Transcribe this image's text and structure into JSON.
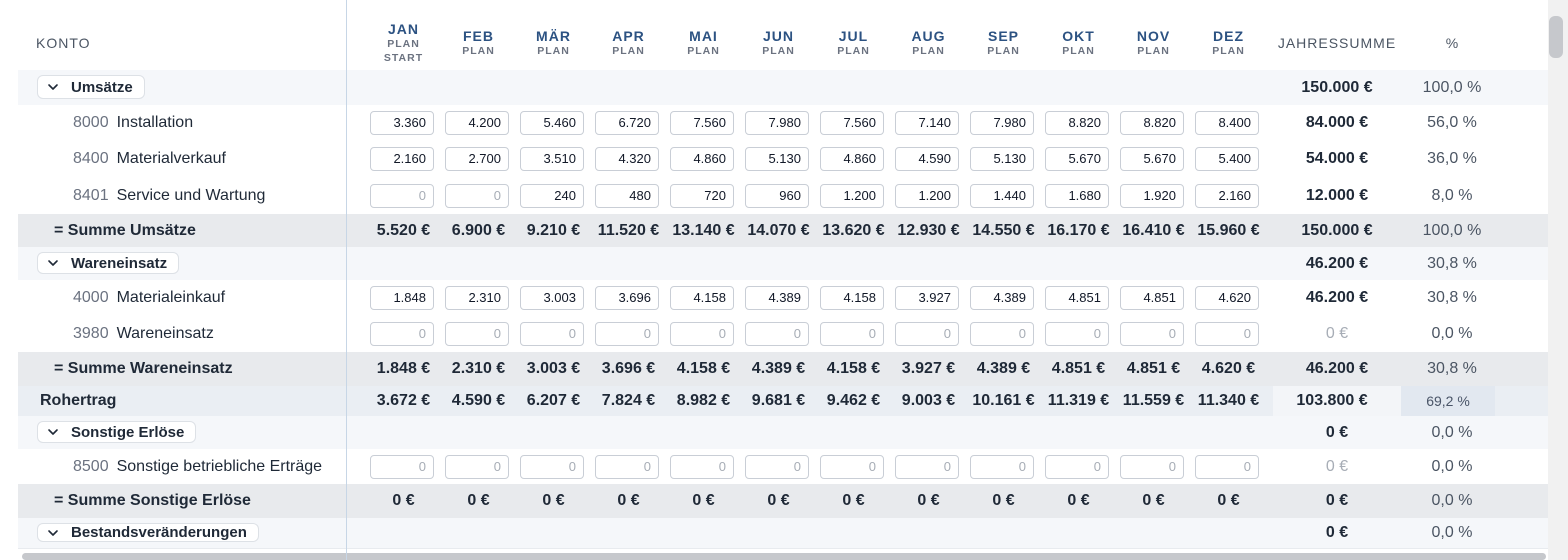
{
  "header": {
    "konto": "KONTO",
    "months": [
      {
        "name": "JAN",
        "l1": "PLAN",
        "l2": "START"
      },
      {
        "name": "FEB",
        "l1": "PLAN"
      },
      {
        "name": "MÄR",
        "l1": "PLAN"
      },
      {
        "name": "APR",
        "l1": "PLAN"
      },
      {
        "name": "MAI",
        "l1": "PLAN"
      },
      {
        "name": "JUN",
        "l1": "PLAN"
      },
      {
        "name": "JUL",
        "l1": "PLAN"
      },
      {
        "name": "AUG",
        "l1": "PLAN"
      },
      {
        "name": "SEP",
        "l1": "PLAN"
      },
      {
        "name": "OKT",
        "l1": "PLAN"
      },
      {
        "name": "NOV",
        "l1": "PLAN"
      },
      {
        "name": "DEZ",
        "l1": "PLAN"
      }
    ],
    "jahressumme": "JAHRESSUMME",
    "percent": "%"
  },
  "rows": [
    {
      "type": "group",
      "label": "Umsätze",
      "sum": "150.000 €",
      "pct": "100,0 %"
    },
    {
      "type": "item",
      "num": "8000",
      "name": "Installation",
      "values": [
        "3.360",
        "4.200",
        "5.460",
        "6.720",
        "7.560",
        "7.980",
        "7.560",
        "7.140",
        "7.980",
        "8.820",
        "8.820",
        "8.400"
      ],
      "sum": "84.000 €",
      "pct": "56,0 %"
    },
    {
      "type": "item",
      "num": "8400",
      "name": "Materialverkauf",
      "values": [
        "2.160",
        "2.700",
        "3.510",
        "4.320",
        "4.860",
        "5.130",
        "4.860",
        "4.590",
        "5.130",
        "5.670",
        "5.670",
        "5.400"
      ],
      "sum": "54.000 €",
      "pct": "36,0 %"
    },
    {
      "type": "item",
      "num": "8401",
      "name": "Service und Wartung",
      "values": [
        "0",
        "0",
        "240",
        "480",
        "720",
        "960",
        "1.200",
        "1.200",
        "1.440",
        "1.680",
        "1.920",
        "2.160"
      ],
      "sum": "12.000 €",
      "pct": "8,0 %"
    },
    {
      "type": "sum",
      "label": "= Summe Umsätze",
      "values": [
        "5.520 €",
        "6.900 €",
        "9.210 €",
        "11.520 €",
        "13.140 €",
        "14.070 €",
        "13.620 €",
        "12.930 €",
        "14.550 €",
        "16.170 €",
        "16.410 €",
        "15.960 €"
      ],
      "sum": "150.000 €",
      "pct": "100,0 %"
    },
    {
      "type": "group",
      "label": "Wareneinsatz",
      "sum": "46.200 €",
      "pct": "30,8 %"
    },
    {
      "type": "item",
      "num": "4000",
      "name": "Materialeinkauf",
      "values": [
        "1.848",
        "2.310",
        "3.003",
        "3.696",
        "4.158",
        "4.389",
        "4.158",
        "3.927",
        "4.389",
        "4.851",
        "4.851",
        "4.620"
      ],
      "sum": "46.200 €",
      "pct": "30,8 %"
    },
    {
      "type": "item",
      "num": "3980",
      "name": "Wareneinsatz",
      "values": [
        "0",
        "0",
        "0",
        "0",
        "0",
        "0",
        "0",
        "0",
        "0",
        "0",
        "0",
        "0"
      ],
      "sum": "0 €",
      "pct": "0,0 %"
    },
    {
      "type": "sum",
      "label": "= Summe Wareneinsatz",
      "values": [
        "1.848 €",
        "2.310 €",
        "3.003 €",
        "3.696 €",
        "4.158 €",
        "4.389 €",
        "4.158 €",
        "3.927 €",
        "4.389 €",
        "4.851 €",
        "4.851 €",
        "4.620 €"
      ],
      "sum": "46.200 €",
      "pct": "30,8 %"
    },
    {
      "type": "roh",
      "label": "Rohertrag",
      "values": [
        "3.672 €",
        "4.590 €",
        "6.207 €",
        "7.824 €",
        "8.982 €",
        "9.681 €",
        "9.462 €",
        "9.003 €",
        "10.161 €",
        "11.319 €",
        "11.559 €",
        "11.340 €"
      ],
      "sum": "103.800 €",
      "pct": "69,2 %"
    },
    {
      "type": "group",
      "label": "Sonstige Erlöse",
      "sum": "0 €",
      "pct": "0,0 %"
    },
    {
      "type": "item",
      "num": "8500",
      "name": "Sonstige betriebliche Erträge",
      "values": [
        "0",
        "0",
        "0",
        "0",
        "0",
        "0",
        "0",
        "0",
        "0",
        "0",
        "0",
        "0"
      ],
      "sum": "0 €",
      "pct": "0,0 %"
    },
    {
      "type": "sum",
      "label": "= Summe Sonstige Erlöse",
      "values": [
        "0 €",
        "0 €",
        "0 €",
        "0 €",
        "0 €",
        "0 €",
        "0 €",
        "0 €",
        "0 €",
        "0 €",
        "0 €",
        "0 €"
      ],
      "sum": "0 €",
      "pct": "0,0 %"
    },
    {
      "type": "group",
      "label": "Bestandsveränderungen",
      "sum": "0 €",
      "pct": "0,0 %"
    }
  ]
}
